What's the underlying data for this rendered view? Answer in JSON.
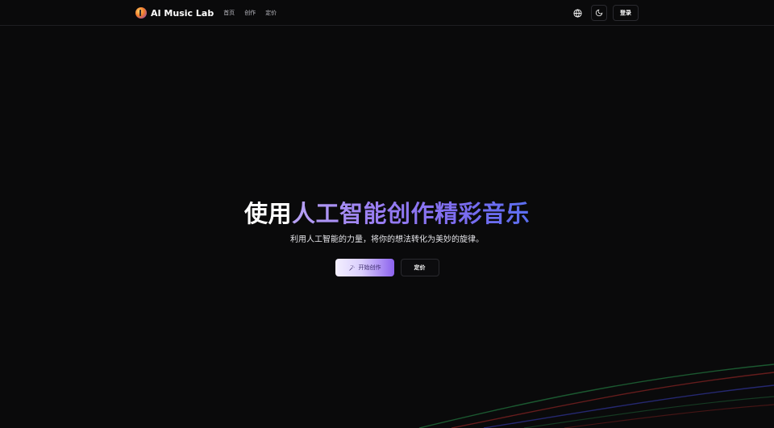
{
  "header": {
    "brand_name": "AI Music Lab",
    "nav": [
      {
        "label": "首页"
      },
      {
        "label": "创作"
      },
      {
        "label": "定价"
      }
    ],
    "language_icon": "globe-icon",
    "theme_icon": "moon-icon",
    "login_label": "登录"
  },
  "hero": {
    "title_plain": "使用",
    "title_highlight": "人工智能创作精彩音乐",
    "subtitle": "利用人工智能的力量，将你的想法转化为美妙的旋律。",
    "primary_cta": {
      "label": "开始创作",
      "icon": "magic-wand-icon"
    },
    "secondary_cta": {
      "label": "定价"
    }
  },
  "colors": {
    "background": "#0a0a0b",
    "accent_start": "#b8a2f5",
    "accent_end": "#5a6ef0"
  }
}
